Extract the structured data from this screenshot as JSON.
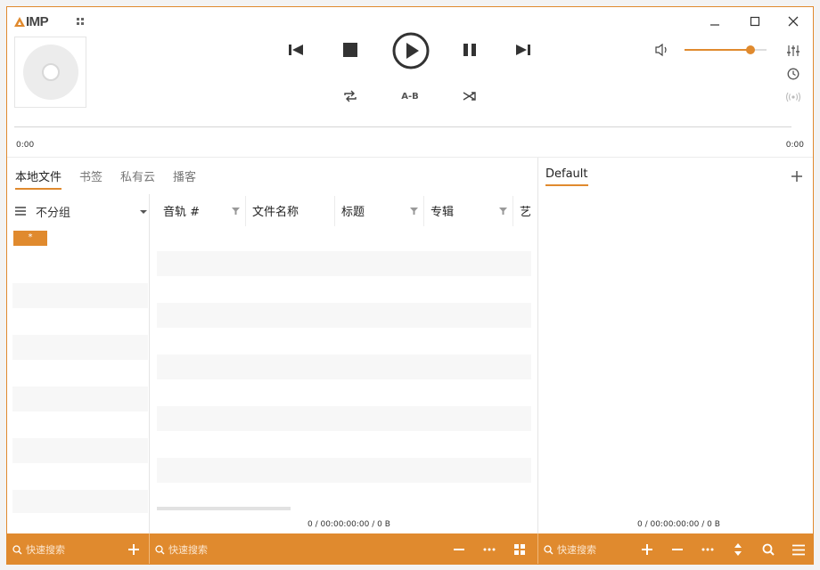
{
  "app": {
    "logo_text": "IMP"
  },
  "player": {
    "time_elapsed": "0:00",
    "time_total": "0:00",
    "ab_label": "A-B",
    "volume_percent": 80
  },
  "library": {
    "tabs": [
      {
        "label": "本地文件",
        "active": true
      },
      {
        "label": "书签",
        "active": false
      },
      {
        "label": "私有云",
        "active": false
      },
      {
        "label": "播客",
        "active": false
      }
    ],
    "group_by": "不分组",
    "group_items": [
      "*"
    ],
    "columns": [
      "音轨 #",
      "文件名称",
      "标题",
      "专辑",
      "艺"
    ],
    "status": "0 / 00:00:00:00 / 0 B",
    "search_placeholder": "快速搜索",
    "tracks_search_placeholder": "快速搜索"
  },
  "playlist": {
    "tab_label": "Default",
    "status": "0 / 00:00:00:00 / 0 B",
    "search_placeholder": "快速搜索"
  },
  "colors": {
    "accent": "#e08a2e"
  }
}
